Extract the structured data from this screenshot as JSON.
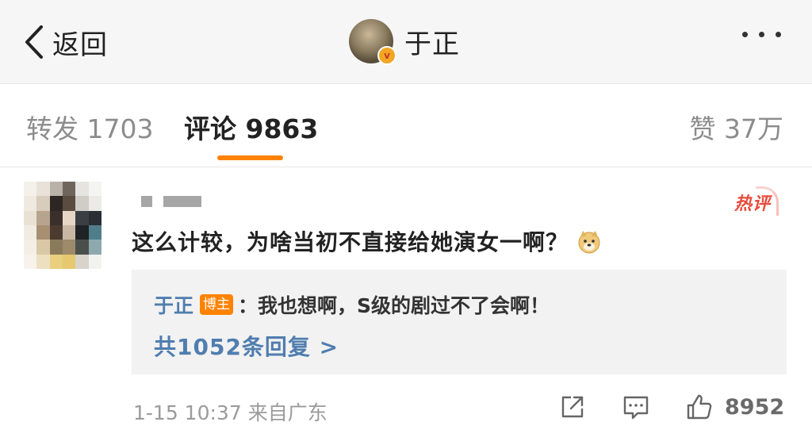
{
  "header": {
    "back_label": "返回",
    "profile_name": "于正",
    "verified_badge": "v"
  },
  "tabs": {
    "repost_label": "转发",
    "repost_count": "1703",
    "comment_label": "评论",
    "comment_count": "9863",
    "like_label": "赞",
    "like_count": "37万",
    "active": "comment",
    "accent_color": "#ff8200"
  },
  "comment": {
    "hot_badge": "热评",
    "text": "这么计较，为啥当初不直接给她演女一啊？",
    "emoji": "doge-icon",
    "reply": {
      "author": "于正",
      "author_tag": "博主",
      "colon": "：",
      "text": "我也想啊，S级的剧过不了会啊！",
      "reply_count_label": "共1052条回复 >"
    },
    "time": "1-15 10:37",
    "source": "来自广东",
    "like_count": "8952",
    "link_color": "#507daf"
  }
}
